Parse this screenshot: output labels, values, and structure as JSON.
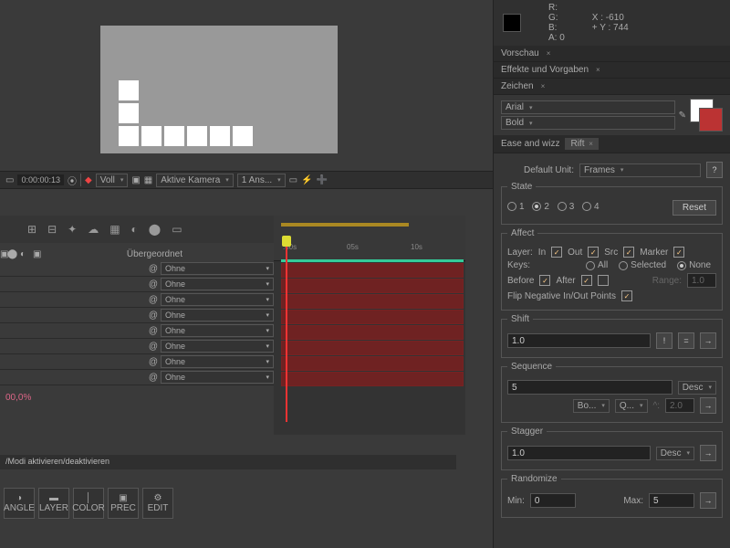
{
  "info": {
    "r": "R:",
    "g": "G:",
    "b": "B:",
    "a": "A:  0",
    "x": "X : -610",
    "y": "Y : 744"
  },
  "panels": {
    "vorschau": "Vorschau",
    "effekte": "Effekte und Vorgaben",
    "zeichen": "Zeichen"
  },
  "char": {
    "font": "Arial",
    "weight": "Bold"
  },
  "footer": {
    "timecode": "0:00:00:13",
    "viewmode": "Voll",
    "camera": "Aktive Kamera",
    "views": "1 Ans..."
  },
  "columns": {
    "parent": "Übergeordnet"
  },
  "layer": {
    "parent_val": "Ohne"
  },
  "percent": "00,0%",
  "status": "/Modi aktivieren/deaktivieren",
  "ruler": {
    "m1": ":00s",
    "m2": "05s",
    "m3": "10s"
  },
  "tools": {
    "angle": "ANGLE",
    "layer": "LAYER",
    "color": "COLOR",
    "prec": "PREC",
    "edit": "EDIT"
  },
  "rift": {
    "tab1": "Ease and wizz",
    "tab2": "Rift",
    "unit_lbl": "Default Unit:",
    "unit_val": "Frames",
    "help": "?",
    "state_lbl": "State",
    "s1": "1",
    "s2": "2",
    "s3": "3",
    "s4": "4",
    "reset": "Reset",
    "affect_lbl": "Affect",
    "layer_lbl": "Layer:",
    "in": "In",
    "out": "Out",
    "src": "Src",
    "marker": "Marker",
    "keys_lbl": "Keys:",
    "all": "All",
    "selected": "Selected",
    "none": "None",
    "before": "Before",
    "after": "After",
    "range": "Range:",
    "range_val": "1.0",
    "flip": "Flip Negative In/Out Points",
    "shift_lbl": "Shift",
    "shift_val": "1.0",
    "excl": "!",
    "eq": "=",
    "arrow": "→",
    "seq_lbl": "Sequence",
    "seq_val": "5",
    "desc": "Desc",
    "bo": "Bo...",
    "q": "Q...",
    "two": "2.0",
    "stag_lbl": "Stagger",
    "stag_val": "1.0",
    "rand_lbl": "Randomize",
    "min": "Min:",
    "min_val": "0",
    "max": "Max:",
    "max_val": "5"
  }
}
